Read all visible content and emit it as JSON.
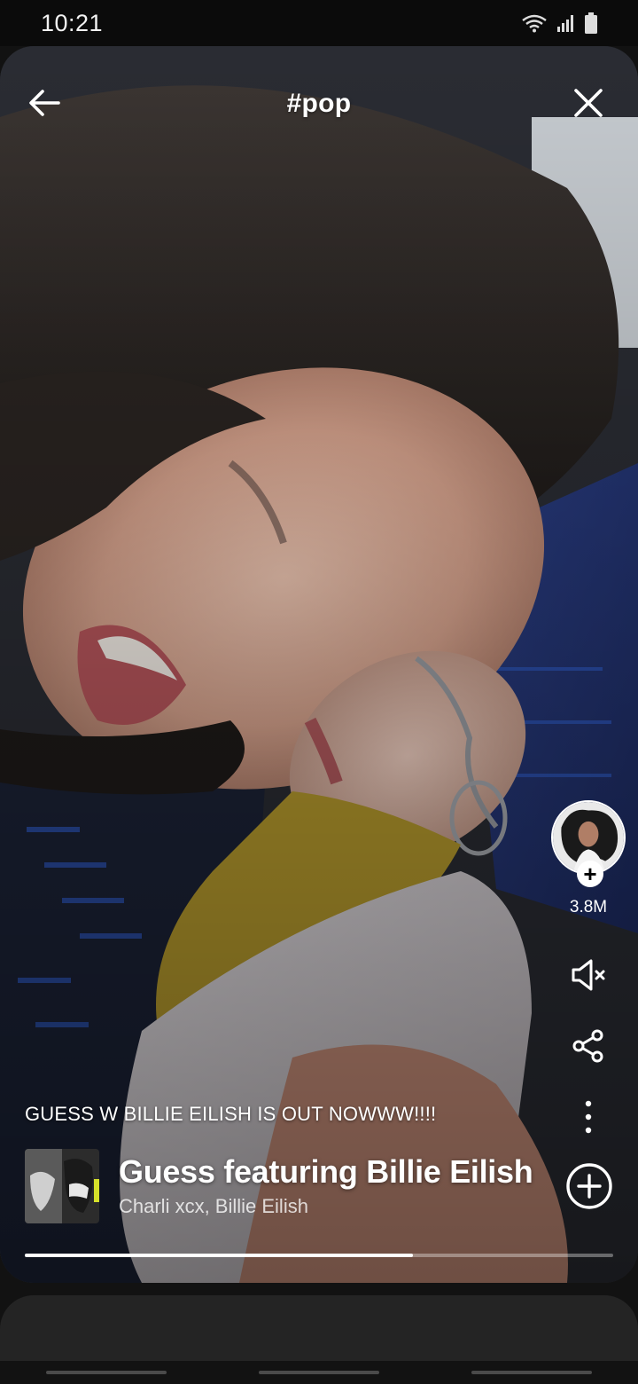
{
  "status_bar": {
    "time": "10:21"
  },
  "header": {
    "title": "#pop"
  },
  "creator": {
    "follower_count": "3.8M",
    "follow_symbol": "+"
  },
  "video": {
    "caption": "GUESS W BILLIE EILISH IS OUT NOWWW!!!!",
    "progress": 0.66
  },
  "track": {
    "title": "Guess featuring Billie Eilish",
    "artists": "Charli xcx, Billie Eilish"
  },
  "icons": {
    "back": "arrow-left-icon",
    "close": "close-icon",
    "mute": "speaker-muted-icon",
    "share": "share-icon",
    "more": "more-vertical-icon",
    "add": "plus-circle-icon"
  },
  "colors": {
    "background": "#121212",
    "sheet": "#242424",
    "accent_yellow": "#d6e12a"
  }
}
